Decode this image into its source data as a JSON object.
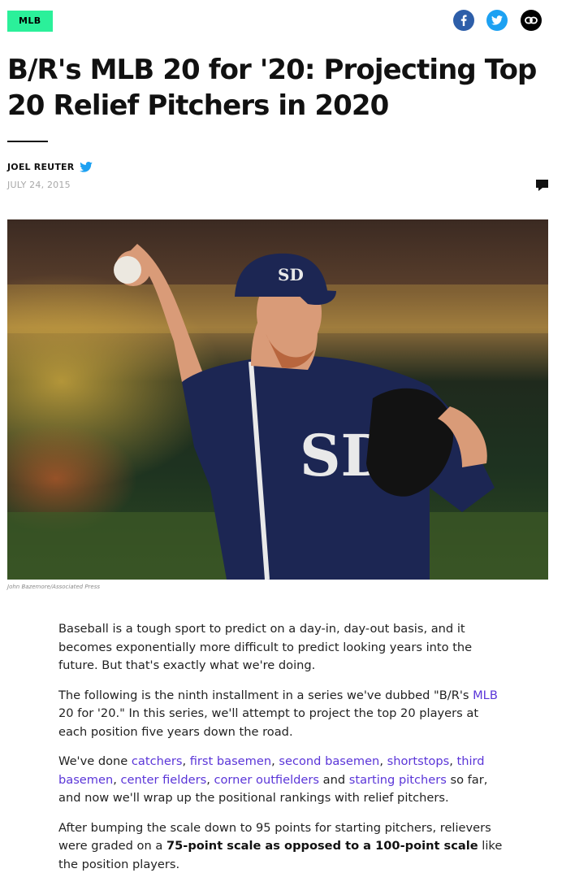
{
  "header": {
    "tag": "MLB",
    "share_icons": [
      "facebook-icon",
      "twitter-icon",
      "link-icon"
    ]
  },
  "article": {
    "title": "B/R's MLB 20 for '20: Projecting Top 20 Relief Pitchers in 2020",
    "author": "JOEL REUTER",
    "date": "JULY 24, 2015",
    "image_caption": "John Bazemore/Associated Press"
  },
  "body": {
    "p1": "Baseball is a tough sport to predict on a day-in, day-out basis, and it becomes exponentially more difficult to predict looking years into the future. But that's exactly what we're doing.",
    "p2": {
      "before": "The following is the ninth installment in a series we've dubbed \"B/R's ",
      "link": "MLB",
      "after": " 20 for '20.\" In this series, we'll attempt to project the top 20 players at each position five years down the road."
    },
    "p3": {
      "lead": "We've done ",
      "links": [
        "catchers",
        "first basemen",
        "second basemen",
        "shortstops",
        "third basemen",
        "center fielders",
        "corner outfielders",
        "starting pitchers"
      ],
      "and": " and ",
      "tail": " so far, and now we'll wrap up the positional rankings with relief pitchers."
    },
    "p4": {
      "before": "After bumping the scale down to 95 points for starting pitchers, relievers were graded on a ",
      "bold": "75-point scale as opposed to a 100-point scale",
      "after": " like the position players."
    }
  },
  "colors": {
    "tag_bg": "#2bf09a",
    "link": "#5a35d8",
    "facebook": "#2d5ea9",
    "twitter": "#1da1f2"
  }
}
